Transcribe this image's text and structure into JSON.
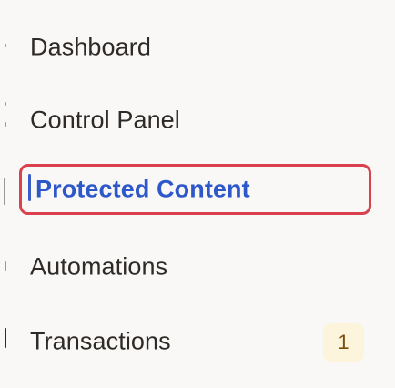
{
  "sidebar": {
    "items": [
      {
        "label": "Dashboard"
      },
      {
        "label": "Control Panel"
      },
      {
        "label": "Protected Content",
        "active": true
      },
      {
        "label": "Automations"
      },
      {
        "label": "Transactions",
        "badge": "1"
      }
    ]
  },
  "colors": {
    "background": "#f9f8f6",
    "text": "#2e2a27",
    "active_text": "#2e58c9",
    "focus_outline": "#d9414f",
    "badge_background": "#fdf4dc",
    "badge_text": "#7a4e0c"
  }
}
